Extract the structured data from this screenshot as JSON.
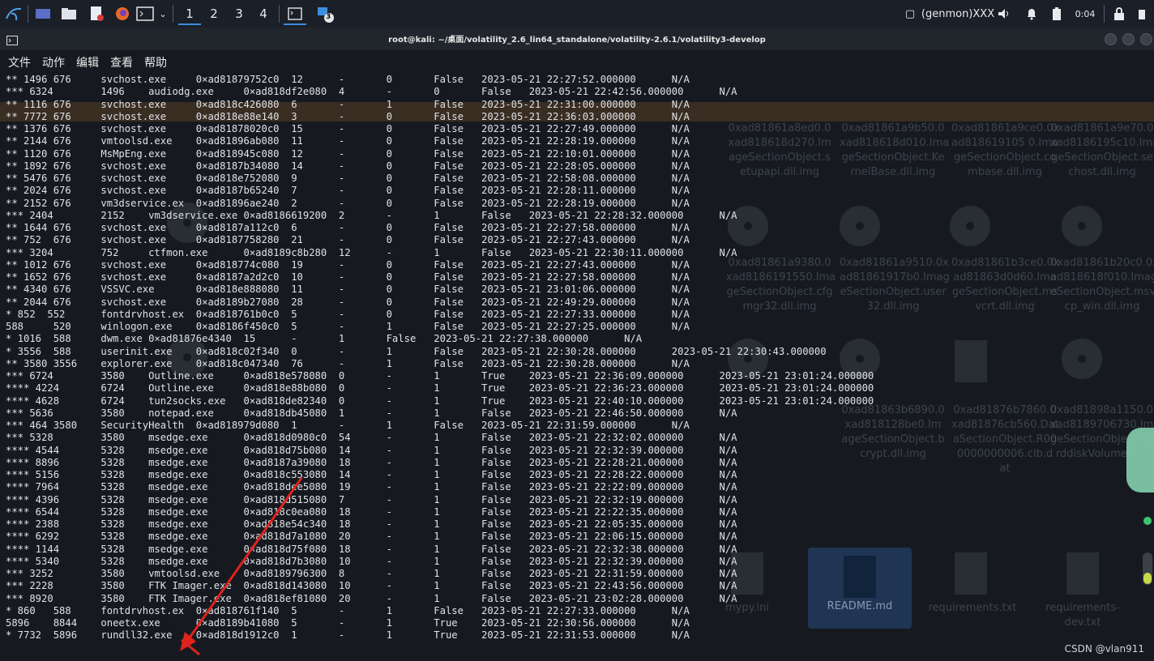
{
  "panel": {
    "workspaces": [
      "1",
      "2",
      "3",
      "4"
    ],
    "badge_count": "3",
    "genmon": "(genmon)XXX",
    "clock": "0:04"
  },
  "window": {
    "title": "root@kali: ~/桌面/volatility_2.6_lin64_standalone/volatility-2.6.1/volatility3-develop"
  },
  "menu": [
    "文件",
    "动作",
    "编辑",
    "查看",
    "帮助"
  ],
  "rows": [
    "** 1496 676     svchost.exe     0×ad81879752c0  12      -       0       False   2023-05-21 22:27:52.000000      N/A",
    "*** 6324        1496    audiodg.exe     0×ad818df2e080  4       -       0       False   2023-05-21 22:42:56.000000      N/A",
    "** 1116 676     svchost.exe     0×ad818c426080  6       -       1       False   2023-05-21 22:31:00.000000      N/A",
    "** 7772 676     svchost.exe     0×ad818e88e140  3       -       0       False   2023-05-21 22:36:03.000000      N/A",
    "** 1376 676     svchost.exe     0×ad81878020c0  15      -       0       False   2023-05-21 22:27:49.000000      N/A",
    "** 2144 676     vmtoolsd.exe    0×ad81896ab080  11      -       0       False   2023-05-21 22:28:19.000000      N/A",
    "** 1120 676     MsMpEng.exe     0×ad818945c080  12      -       0       False   2023-05-21 22:10:01.000000      N/A",
    "** 1892 676     svchost.exe     0×ad8187b34080  14      -       0       False   2023-05-21 22:28:05.000000      N/A",
    "** 5476 676     svchost.exe     0×ad818e752080  9       -       0       False   2023-05-21 22:58:08.000000      N/A",
    "** 2024 676     svchost.exe     0×ad8187b65240  7       -       0       False   2023-05-21 22:28:11.000000      N/A",
    "** 2152 676     vm3dservice.ex  0×ad81896ae240  2       -       0       False   2023-05-21 22:28:19.000000      N/A",
    "*** 2404        2152    vm3dservice.exe 0×ad8186619200  2       -       1       False   2023-05-21 22:28:32.000000      N/A",
    "** 1644 676     svchost.exe     0×ad8187a112c0  6       -       0       False   2023-05-21 22:27:58.000000      N/A",
    "** 752  676     svchost.exe     0×ad8187758280  21      -       0       False   2023-05-21 22:27:43.000000      N/A",
    "*** 3204        752     ctfmon.exe      0×ad8189c8b280  12      -       1       False   2023-05-21 22:30:11.000000      N/A",
    "** 1012 676     svchost.exe     0×ad818774c080  19      -       0       False   2023-05-21 22:27:43.000000      N/A",
    "** 1652 676     svchost.exe     0×ad8187a2d2c0  10      -       0       False   2023-05-21 22:27:58.000000      N/A",
    "** 4340 676     VSSVC.exe       0×ad818e888080  11      -       0       False   2023-05-21 23:01:06.000000      N/A",
    "** 2044 676     svchost.exe     0×ad8189b27080  28      -       0       False   2023-05-21 22:49:29.000000      N/A",
    "* 852  552      fontdrvhost.ex  0×ad818761b0c0  5       -       0       False   2023-05-21 22:27:33.000000      N/A",
    "588     520     winlogon.exe    0×ad8186f450c0  5       -       1       False   2023-05-21 22:27:25.000000      N/A",
    "* 1016  588     dwm.exe 0×ad81876e4340  15      -       1       False   2023-05-21 22:27:38.000000      N/A",
    "* 3556  588     userinit.exe    0×ad818c02f340  0       -       1       False   2023-05-21 22:30:28.000000      2023-05-21 22:30:43.000000",
    "** 3580 3556    explorer.exe    0×ad818c047340  76      -       1       False   2023-05-21 22:30:28.000000      N/A",
    "*** 6724        3580    Outline.exe     0×ad818e578080  0       -       1       True    2023-05-21 22:36:09.000000      2023-05-21 23:01:24.000000",
    "**** 4224       6724    Outline.exe     0×ad818e88b080  0       -       1       True    2023-05-21 22:36:23.000000      2023-05-21 23:01:24.000000",
    "**** 4628       6724    tun2socks.exe   0×ad818de82340  0       -       1       True    2023-05-21 22:40:10.000000      2023-05-21 23:01:24.000000",
    "*** 5636        3580    notepad.exe     0×ad818db45080  1       -       1       False   2023-05-21 22:46:50.000000      N/A",
    "*** 464 3580    SecurityHealth  0×ad818979d080  1       -       1       False   2023-05-21 22:31:59.000000      N/A",
    "*** 5328        3580    msedge.exe      0×ad818d0980c0  54      -       1       False   2023-05-21 22:32:02.000000      N/A",
    "**** 4544       5328    msedge.exe      0×ad818d75b080  14      -       1       False   2023-05-21 22:32:39.000000      N/A",
    "**** 8896       5328    msedge.exe      0×ad8187a39080  18      -       1       False   2023-05-21 22:28:21.000000      N/A",
    "**** 5156       5328    msedge.exe      0×ad818c553080  14      -       1       False   2023-05-21 22:28:22.000000      N/A",
    "**** 7964       5328    msedge.exe      0×ad818dee5080  19      -       1       False   2023-05-21 22:22:09.000000      N/A",
    "**** 4396       5328    msedge.exe      0×ad818d515080  7       -       1       False   2023-05-21 22:32:19.000000      N/A",
    "**** 6544       5328    msedge.exe      0×ad818c0ea080  18      -       1       False   2023-05-21 22:22:35.000000      N/A",
    "**** 2388       5328    msedge.exe      0×ad818e54c340  18      -       1       False   2023-05-21 22:05:35.000000      N/A",
    "**** 6292       5328    msedge.exe      0×ad818d7a1080  20      -       1       False   2023-05-21 22:06:15.000000      N/A",
    "**** 1144       5328    msedge.exe      0×ad818d75f080  18      -       1       False   2023-05-21 22:32:38.000000      N/A",
    "**** 5340       5328    msedge.exe      0×ad818d7b3080  10      -       1       False   2023-05-21 22:32:39.000000      N/A",
    "*** 3252        3580    vmtoolsd.exe    0×ad8189796300  8       -       1       False   2023-05-21 22:31:59.000000      N/A",
    "*** 2228        3580    FTK Imager.exe  0×ad818d143080  10      -       1       False   2023-05-21 22:43:56.000000      N/A",
    "*** 8920        3580    FTK Imager.exe  0×ad818ef81080  20      -       1       False   2023-05-21 23:02:28.000000      N/A",
    "* 860   588     fontdrvhost.ex  0×ad818761f140  5       -       1       False   2023-05-21 22:27:33.000000      N/A",
    "5896    8844    oneetx.exe      0×ad8189b41080  5       -       1       True    2023-05-21 22:30:56.000000      N/A",
    "* 7732  5896    rundll32.exe    0×ad818d1912c0  1       -       1       True    2023-05-21 22:31:53.000000      N/A"
  ],
  "ghost": {
    "files_row1": [
      "0xad81861a8ed0.0\nxad818618d270.Im\nageSectionObject.s\netupapi.dll.img",
      "0xad81861a9b50.0\nxad818618d010.Ima\ngeSectionObject.Ke\nrnelBase.dll.img",
      "0xad81861a9ce0.0x\nad818619105 0.Ima\ngeSectionObject.co\nmbase.dll.img",
      "0xad81861a9e70.0\nxad8186195c10.Ima\ngeSectionObject.se\nchost.dll.img"
    ],
    "files_row2": [
      "0xad81861a9380.0\nxad8186191550.Ima\ngeSectionObject.cfg\nmgr32.dll.img",
      "0xad81861a9510.0x\nad81861917b0.Imag\neSectionObject.user\n32.dll.img",
      "0xad81861b3ce0.0x\nad81863d0d60.Ima\ngeSectionObject.ms\nvcrt.dll.img",
      "0xad81861b20c0.0x\nad818618f010.Imag\neSectionObject.msv\ncp_win.dll.img"
    ],
    "files_row3": [
      "0xad81863b6890.0\nxad818128be0.Im\nageSectionObject.b\ncrypt.dll.img",
      "0xad81876b7860.0\nxad81876cb560.Dat\naSectionObject.R00\n0000000006.clb.d\nat",
      "0xad81898a1150.0\nxad8189706730.Ima\ngeSectionObject.Ha\nrddiskVolume3"
    ],
    "readme": "README.md",
    "requirements": "requirements.txt",
    "requirements_dev": "requirements-\ndev.txt",
    "mypy": "mypy.ini"
  },
  "watermark": "CSDN @vlan911"
}
